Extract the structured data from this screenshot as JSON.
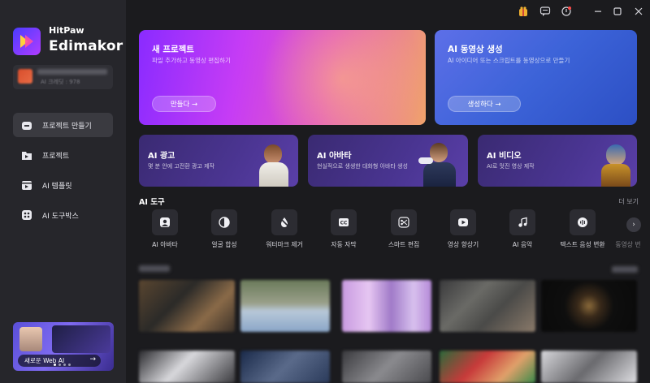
{
  "window": {
    "controls": [
      "gift-icon",
      "feedback-icon",
      "update-icon",
      "minimize-icon",
      "maximize-icon",
      "close-icon"
    ]
  },
  "sidebar": {
    "brand_top": "HitPaw",
    "brand_main": "Edimakor",
    "credits_text": "AI 크레딧 : 978",
    "items": [
      {
        "label": "프로젝트 만들기",
        "icon": "home-icon",
        "active": true
      },
      {
        "label": "프로젝트",
        "icon": "folder-icon",
        "active": false
      },
      {
        "label": "AI 템플릿",
        "icon": "template-icon",
        "active": false
      },
      {
        "label": "AI 도구박스",
        "icon": "toolbox-icon",
        "active": false
      }
    ],
    "promo": {
      "label": "새로운 Web AI",
      "arrow": "→"
    }
  },
  "hero": {
    "new_project": {
      "title": "새 프로젝트",
      "desc": "파일 추가하고 동영상 편집하기",
      "button": "만들다 →"
    },
    "ai_video": {
      "title": "AI 동영상 생성",
      "desc": "AI 아이디어 또는 스크립트를 동영상으로 만들기",
      "button": "생성하다 →"
    }
  },
  "features": [
    {
      "title": "AI 광고",
      "desc": "몇 분 안에 고전환 광고 제작"
    },
    {
      "title": "AI 아바타",
      "desc": "현실적으로 생생한 대화형 아바타 생성"
    },
    {
      "title": "AI 비디오",
      "desc": "AI로 멋진 영상 제작"
    }
  ],
  "tools": {
    "title": "AI 도구",
    "more": "더 보기",
    "items": [
      {
        "label": "AI 아바타",
        "icon": "avatar-icon"
      },
      {
        "label": "얼굴 합성",
        "icon": "face-swap-icon"
      },
      {
        "label": "워터마크 제거",
        "icon": "watermark-remove-icon"
      },
      {
        "label": "자동 자막",
        "icon": "caption-icon"
      },
      {
        "label": "스마트 편집",
        "icon": "smart-edit-icon"
      },
      {
        "label": "영상 향상기",
        "icon": "video-enhance-icon"
      },
      {
        "label": "AI 음악",
        "icon": "music-icon"
      },
      {
        "label": "텍스트 음성 변환",
        "icon": "tts-icon"
      },
      {
        "label": "동영상 번",
        "icon": "translate-icon"
      }
    ]
  },
  "colors": {
    "bg": "#1b1b1e",
    "sidebar": "#26262b",
    "accent_purple": "#c13cff",
    "accent_blue": "#3f6ee0"
  }
}
